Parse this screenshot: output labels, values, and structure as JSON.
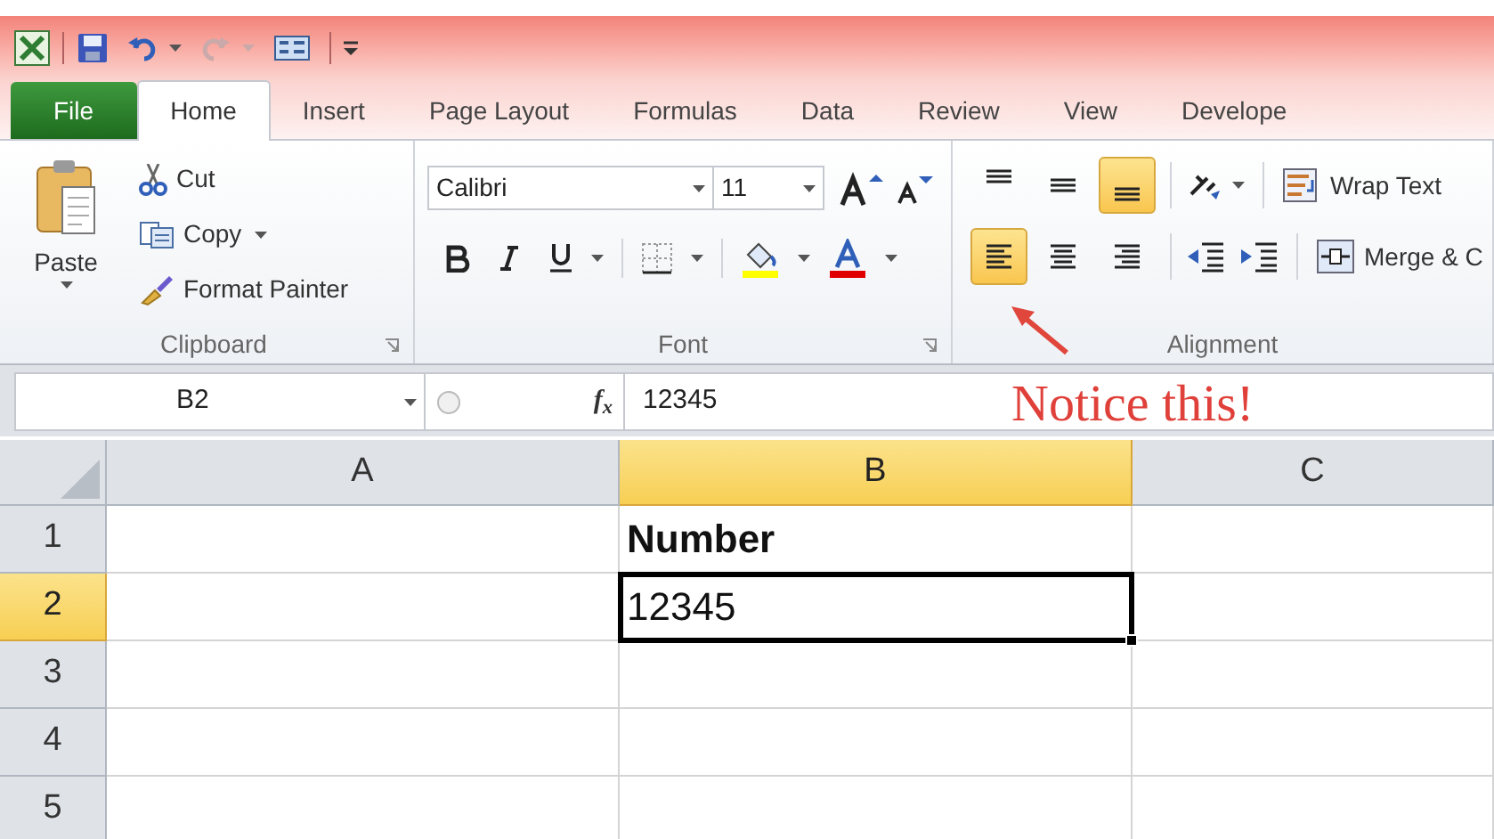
{
  "tabs": [
    {
      "label": "File",
      "kind": "file",
      "selected": false
    },
    {
      "label": "Home",
      "kind": "tab",
      "selected": true
    },
    {
      "label": "Insert",
      "kind": "tab",
      "selected": false
    },
    {
      "label": "Page Layout",
      "kind": "tab",
      "selected": false
    },
    {
      "label": "Formulas",
      "kind": "tab",
      "selected": false
    },
    {
      "label": "Data",
      "kind": "tab",
      "selected": false
    },
    {
      "label": "Review",
      "kind": "tab",
      "selected": false
    },
    {
      "label": "View",
      "kind": "tab",
      "selected": false
    },
    {
      "label": "Develope",
      "kind": "tab",
      "selected": false
    }
  ],
  "ribbon": {
    "clipboard": {
      "paste": "Paste",
      "cut": "Cut",
      "copy": "Copy",
      "format_painter": "Format Painter",
      "label": "Clipboard"
    },
    "font": {
      "font_name": "Calibri",
      "font_size": "11",
      "label": "Font"
    },
    "alignment": {
      "vertical": [
        {
          "kind": "top",
          "selected": false
        },
        {
          "kind": "middle",
          "selected": false
        },
        {
          "kind": "bottom",
          "selected": true
        }
      ],
      "horizontal": [
        {
          "kind": "left",
          "selected": true
        },
        {
          "kind": "center",
          "selected": false
        },
        {
          "kind": "right",
          "selected": false
        }
      ],
      "wrap_text": "Wrap Text",
      "merge": "Merge & C",
      "label": "Alignment"
    }
  },
  "formula_bar": {
    "name_box": "B2",
    "fx": "f$_{x}$",
    "formula": "12345"
  },
  "annotation": {
    "text": "Notice this!"
  },
  "sheet": {
    "columns": [
      {
        "label": "A",
        "selected": false
      },
      {
        "label": "B",
        "selected": true
      },
      {
        "label": "C",
        "selected": false
      }
    ],
    "rows": [
      {
        "label": "1",
        "selected": false,
        "cells": [
          {
            "active": false
          },
          {
            "text": "Number",
            "active": false
          },
          {
            "active": false
          }
        ]
      },
      {
        "label": "2",
        "selected": true,
        "cells": [
          {
            "active": false
          },
          {
            "text": "12345",
            "active": true
          },
          {
            "active": false
          }
        ]
      },
      {
        "label": "3",
        "selected": false,
        "cells": [
          {
            "active": false
          },
          {
            "active": false
          },
          {
            "active": false
          }
        ]
      },
      {
        "label": "4",
        "selected": false,
        "cells": [
          {
            "active": false
          },
          {
            "active": false
          },
          {
            "active": false
          }
        ]
      },
      {
        "label": "5",
        "selected": false,
        "cells": [
          {
            "active": false
          },
          {
            "active": false
          },
          {
            "active": false
          }
        ]
      }
    ]
  }
}
